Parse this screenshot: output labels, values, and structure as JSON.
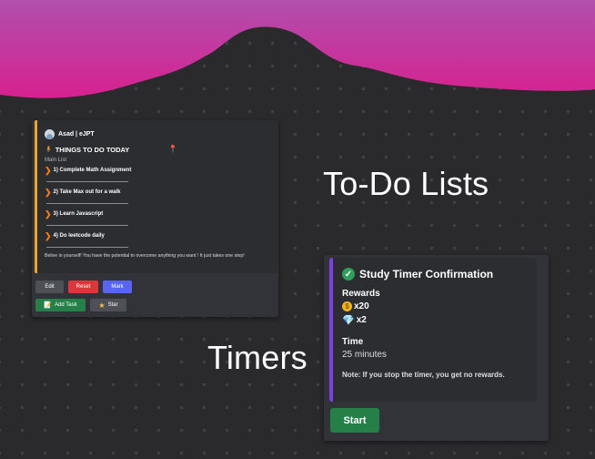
{
  "colors": {
    "wave_top": "#b14fae",
    "wave_bottom": "#d7218f",
    "background": "#2a2a2d",
    "todo_accent": "#f0a32a",
    "timer_accent": "#7b3fe4"
  },
  "headings": {
    "todo": "To-Do Lists",
    "timers": "Timers"
  },
  "todo_embed": {
    "author": "Asad | eJPT",
    "title": "THINGS TO DO TODAY",
    "title_icon": "person-icon",
    "pin_icon": "pin-icon",
    "subheading": "Main List",
    "tasks": [
      "1) Complete Math Assignment",
      "2) Take Max out for a walk",
      "3) Learn Javascript",
      "4) Do leetcode daily"
    ],
    "motto": "Belive in yourself! You have the potential to overcome anything you want ! It just takes one step!",
    "buttons": {
      "edit": "Edit",
      "reset": "Reset",
      "mark": "Mark",
      "add_task": "Add Task",
      "star": "Star"
    }
  },
  "timer_embed": {
    "title": "Study Timer Confirmation",
    "rewards_label": "Rewards",
    "coins": "x20",
    "gems": "x2",
    "time_label": "Time",
    "time_value": "25 minutes",
    "note": "Note: If you stop the timer, you get no rewards.",
    "start": "Start"
  }
}
